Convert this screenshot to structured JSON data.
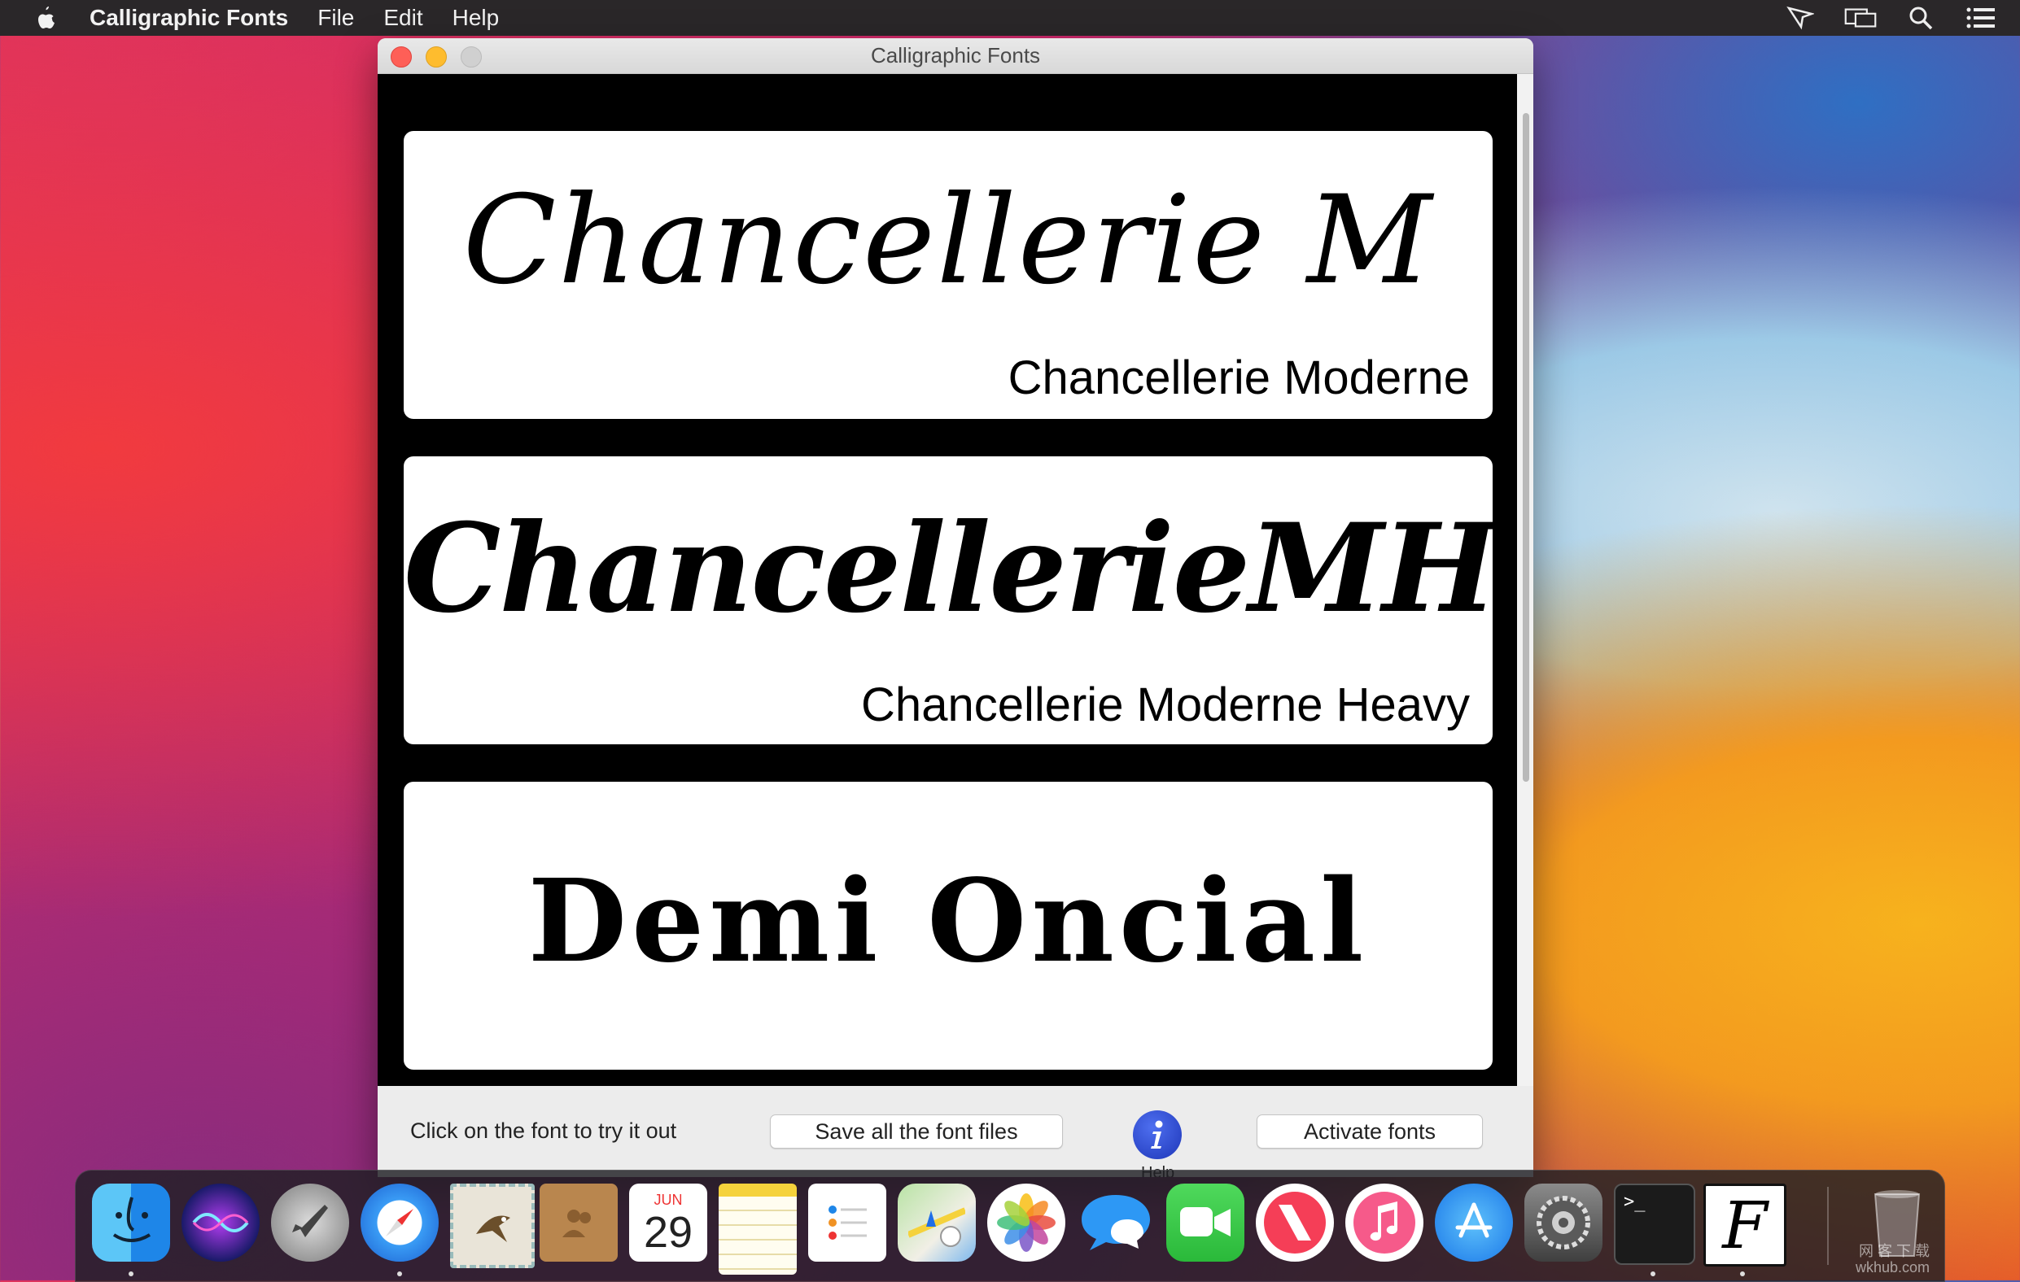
{
  "menubar": {
    "app_name": "Calligraphic Fonts",
    "menus": [
      "File",
      "Edit",
      "Help"
    ]
  },
  "window": {
    "title": "Calligraphic Fonts"
  },
  "fonts": [
    {
      "sample": "Chancellerie M",
      "name": "Chancellerie Moderne"
    },
    {
      "sample": "ChancellerieMH",
      "name": "Chancellerie Moderne Heavy"
    },
    {
      "sample": "Demi Oncial",
      "name": ""
    }
  ],
  "controls": {
    "hint": "Click on the font to try it out",
    "save_label": "Save all the font files",
    "help_label": "Help",
    "activate_label": "Activate fonts"
  },
  "dock": {
    "calendar_month": "JUN",
    "calendar_day": "29",
    "terminal_prompt": ">_",
    "fonts_app_letter": "F",
    "watermark_line1": "网 客 下 载",
    "watermark_line2": "wkhub.com"
  },
  "colors": {
    "accent": "#1e36b8",
    "close": "#fe5f57",
    "minimize": "#febc2e"
  }
}
